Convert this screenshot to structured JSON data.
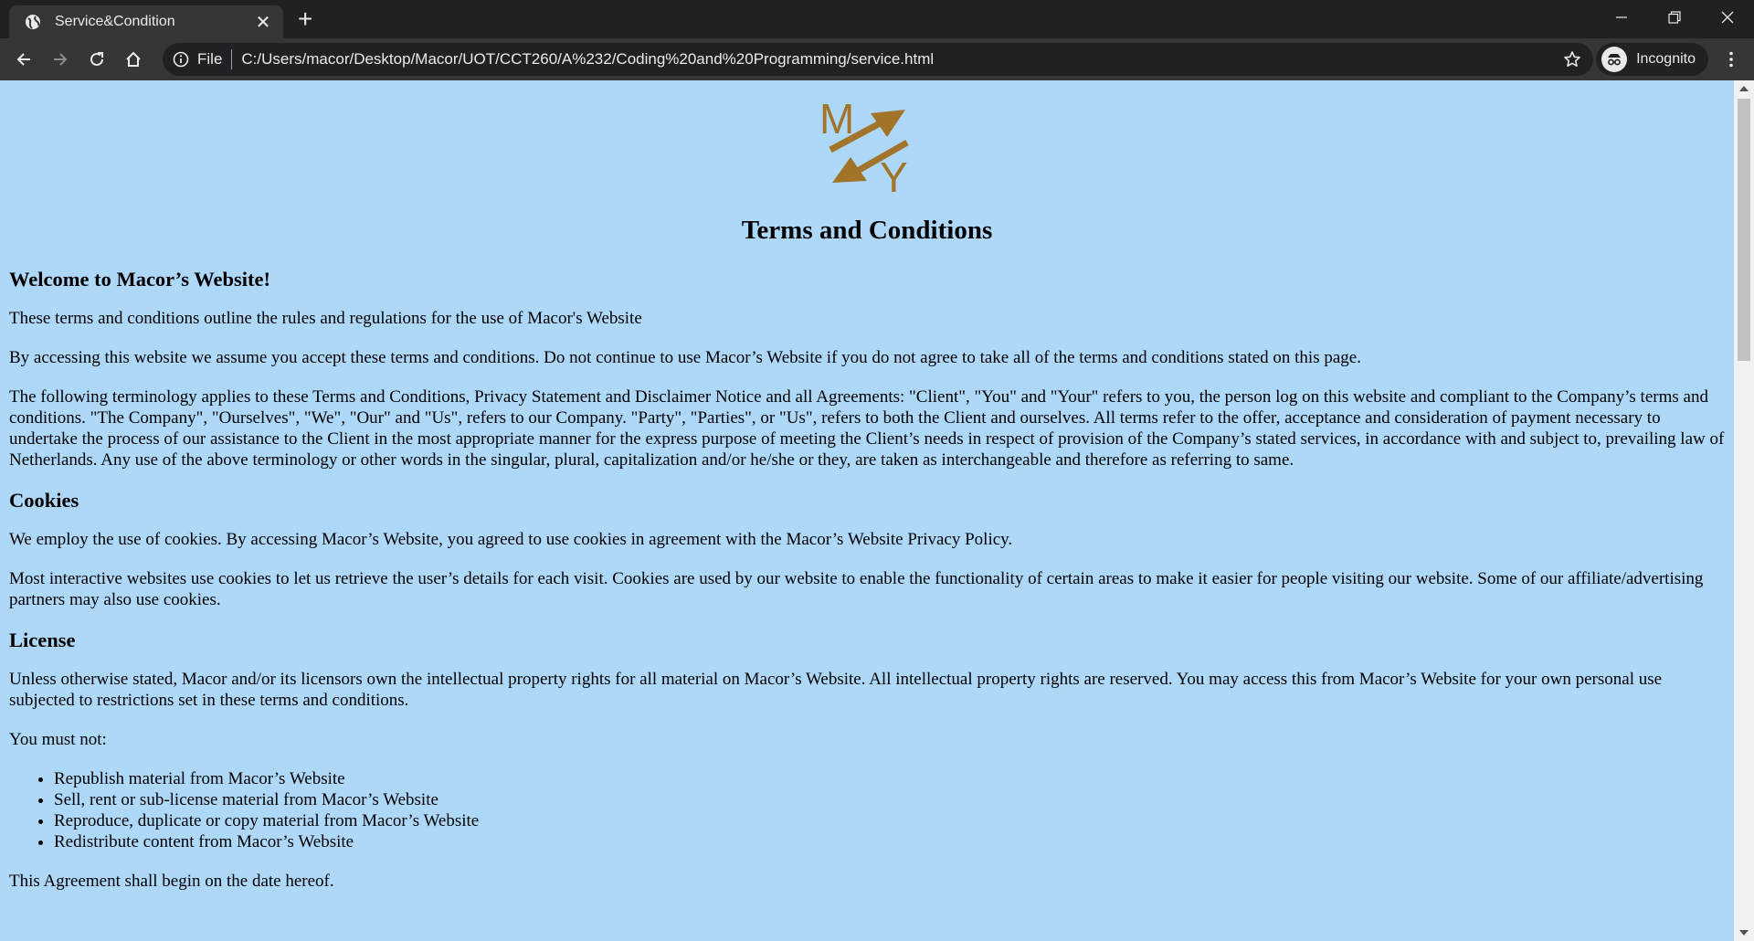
{
  "browser": {
    "tab_title": "Service&Condition",
    "tab_close": "✕",
    "new_tab": "+",
    "address_scheme": "File",
    "address_url": "C:/Users/macor/Desktop/Macor/UOT/CCT260/A%232/Coding%20and%20Programming/service.html",
    "incognito_label": "Incognito"
  },
  "logo": {
    "letter_top": "M",
    "letter_bottom": "Y",
    "color": "#a2742a"
  },
  "page": {
    "title": "Terms and Conditions",
    "welcome_heading": "Welcome to Macor’s Website!",
    "welcome_p1": "These terms and conditions outline the rules and regulations for the use of Macor's Website",
    "welcome_p2": "By accessing this website we assume you accept these terms and conditions. Do not continue to use Macor’s Website if you do not agree to take all of the terms and conditions stated on this page.",
    "welcome_p3": "The following terminology applies to these Terms and Conditions, Privacy Statement and Disclaimer Notice and all Agreements: \"Client\", \"You\" and \"Your\" refers to you, the person log on this website and compliant to the Company’s terms and conditions. \"The Company\", \"Ourselves\", \"We\", \"Our\" and \"Us\", refers to our Company. \"Party\", \"Parties\", or \"Us\", refers to both the Client and ourselves. All terms refer to the offer, acceptance and consideration of payment necessary to undertake the process of our assistance to the Client in the most appropriate manner for the express purpose of meeting the Client’s needs in respect of provision of the Company’s stated services, in accordance with and subject to, prevailing law of Netherlands. Any use of the above terminology or other words in the singular, plural, capitalization and/or he/she or they, are taken as interchangeable and therefore as referring to same.",
    "cookies_heading": "Cookies",
    "cookies_p1": "We employ the use of cookies. By accessing Macor’s Website, you agreed to use cookies in agreement with the Macor’s Website Privacy Policy.",
    "cookies_p2": "Most interactive websites use cookies to let us retrieve the user’s details for each visit. Cookies are used by our website to enable the functionality of certain areas to make it easier for people visiting our website. Some of our affiliate/advertising partners may also use cookies.",
    "license_heading": "License",
    "license_p1": "Unless otherwise stated, Macor and/or its licensors own the intellectual property rights for all material on Macor’s Website. All intellectual property rights are reserved. You may access this from Macor’s Website for your own personal use subjected to restrictions set in these terms and conditions.",
    "must_not": "You must not:",
    "must_not_items": [
      "Republish material from Macor’s Website",
      "Sell, rent or sub-license material from Macor’s Website",
      "Reproduce, duplicate or copy material from Macor’s Website",
      "Redistribute content from Macor’s Website"
    ],
    "agreement": "This Agreement shall begin on the date hereof."
  },
  "colors": {
    "page_bg": "#add8fa",
    "chrome_dark": "#202124",
    "chrome_toolbar": "#35363a"
  }
}
